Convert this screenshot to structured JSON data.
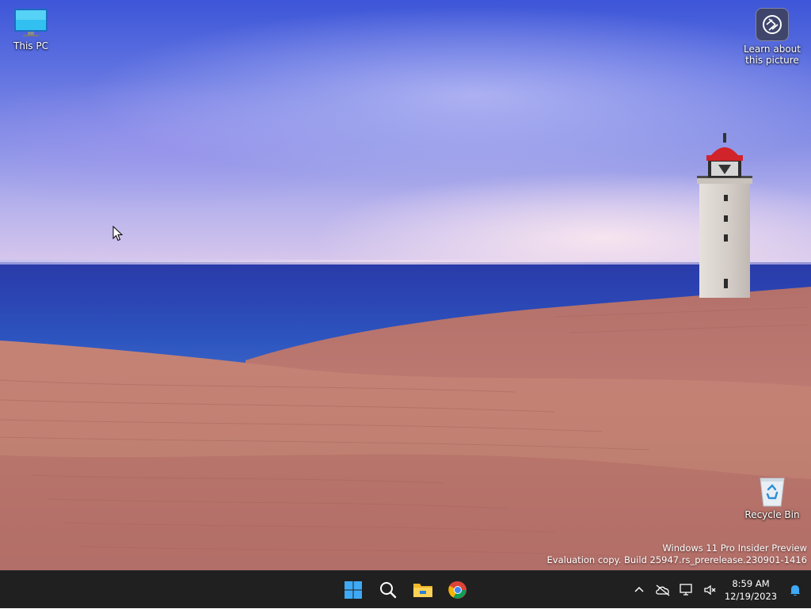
{
  "desktop": {
    "icons": {
      "this_pc": "This PC",
      "learn_about": "Learn about\nthis picture",
      "recycle_bin": "Recycle Bin"
    },
    "watermark": {
      "line1": "Windows 11 Pro Insider Preview",
      "line2": "Evaluation copy. Build 25947.rs_prerelease.230901-1416"
    }
  },
  "taskbar": {
    "apps": [
      {
        "name": "start",
        "icon": "windows-logo-icon"
      },
      {
        "name": "search",
        "icon": "search-icon"
      },
      {
        "name": "file-explorer",
        "icon": "folder-icon"
      },
      {
        "name": "chrome",
        "icon": "chrome-icon"
      }
    ],
    "tray": {
      "icons": [
        "chevron-up-icon",
        "onedrive-icon",
        "network-icon",
        "volume-muted-icon"
      ],
      "time": "8:59 AM",
      "date": "12/19/2023",
      "notification_icon": "bell-icon"
    }
  },
  "colors": {
    "taskbar_bg": "#202020",
    "accent_blue": "#3fa9f5"
  }
}
